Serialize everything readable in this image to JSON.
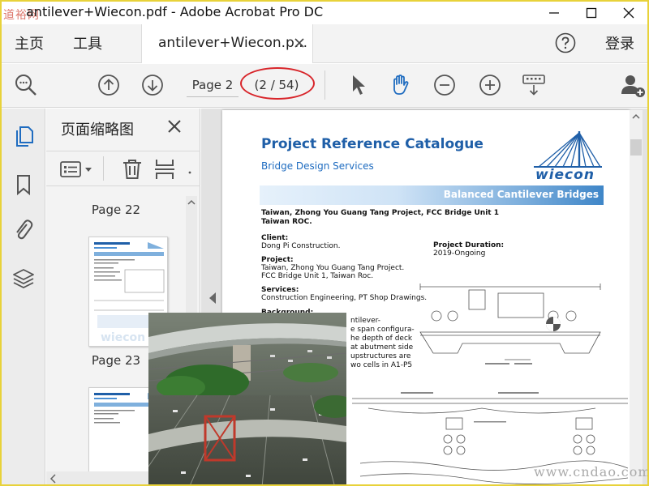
{
  "window": {
    "title": "antilever+Wiecon.pdf - Adobe Acrobat Pro DC",
    "watermark_top": "道裕网"
  },
  "menu": {
    "home": "主页",
    "tools": "工具",
    "login": "登录"
  },
  "tab": {
    "label": "antilever+Wiecon.p..."
  },
  "toolbar": {
    "page_field": "Page 2",
    "page_count": "(2 / 54)"
  },
  "panel": {
    "title": "页面缩略图",
    "thumbnails": [
      {
        "label": "Page 22"
      },
      {
        "label": "Page 23"
      }
    ]
  },
  "document": {
    "title": "Project Reference Catalogue",
    "subtitle": "Bridge Design Services",
    "logo": "wiecon",
    "band_label": "Balanced Cantilever Bridges",
    "heading1": "Taiwan, Zhong You Guang Tang Project, FCC Bridge Unit 1",
    "heading2": "Taiwan ROC.",
    "client_label": "Client:",
    "client_value": "Dong Pi Construction.",
    "duration_label": "Project Duration:",
    "duration_value": "2019-Ongoing",
    "project_label": "Project:",
    "project_line1": "Taiwan, Zhong You Guang Tang Project.",
    "project_line2": "FCC Bridge Unit 1, Taiwan Roc.",
    "services_label": "Services:",
    "services_value": "Construction Engineering, PT Shop Drawings.",
    "background_label": "Background:",
    "bg_line1": "ntilever-",
    "bg_line2": "e span configura-",
    "bg_line3": "he depth of deck",
    "bg_line4": "at abutment side",
    "bg_line5": "upstructures are",
    "bg_line6": "wo cells in A1-P5"
  },
  "watermark_bottom": "www.cndao.com",
  "colors": {
    "accent_blue": "#1f5fa8",
    "highlight_red": "#d8252a",
    "window_border": "#e8d23a"
  }
}
